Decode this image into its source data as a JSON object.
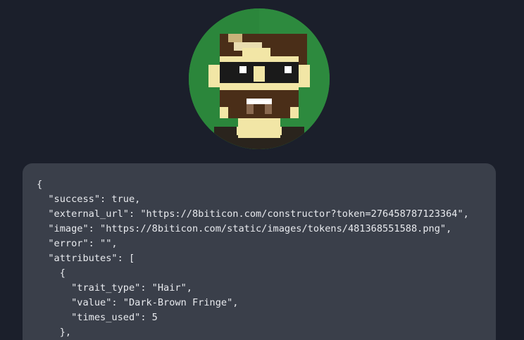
{
  "avatar": {
    "icon": "pixel-avatar-icon",
    "colors": {
      "background": "#2d8a3e",
      "hair": "#4a2e18",
      "skin": "#f2e6a6",
      "glasses": "#1a1a1a",
      "beard": "#4a2e18",
      "shirt": "#2a241d"
    }
  },
  "response": {
    "lines": [
      "{",
      "  \"success\": true,",
      "  \"external_url\": \"https://8biticon.com/constructor?token=276458787123364\",",
      "  \"image\": \"https://8biticon.com/static/images/tokens/481368551588.png\",",
      "  \"error\": \"\",",
      "  \"attributes\": [",
      "    {",
      "      \"trait_type\": \"Hair\",",
      "      \"value\": \"Dark-Brown Fringe\",",
      "      \"times_used\": 5",
      "    },"
    ]
  }
}
